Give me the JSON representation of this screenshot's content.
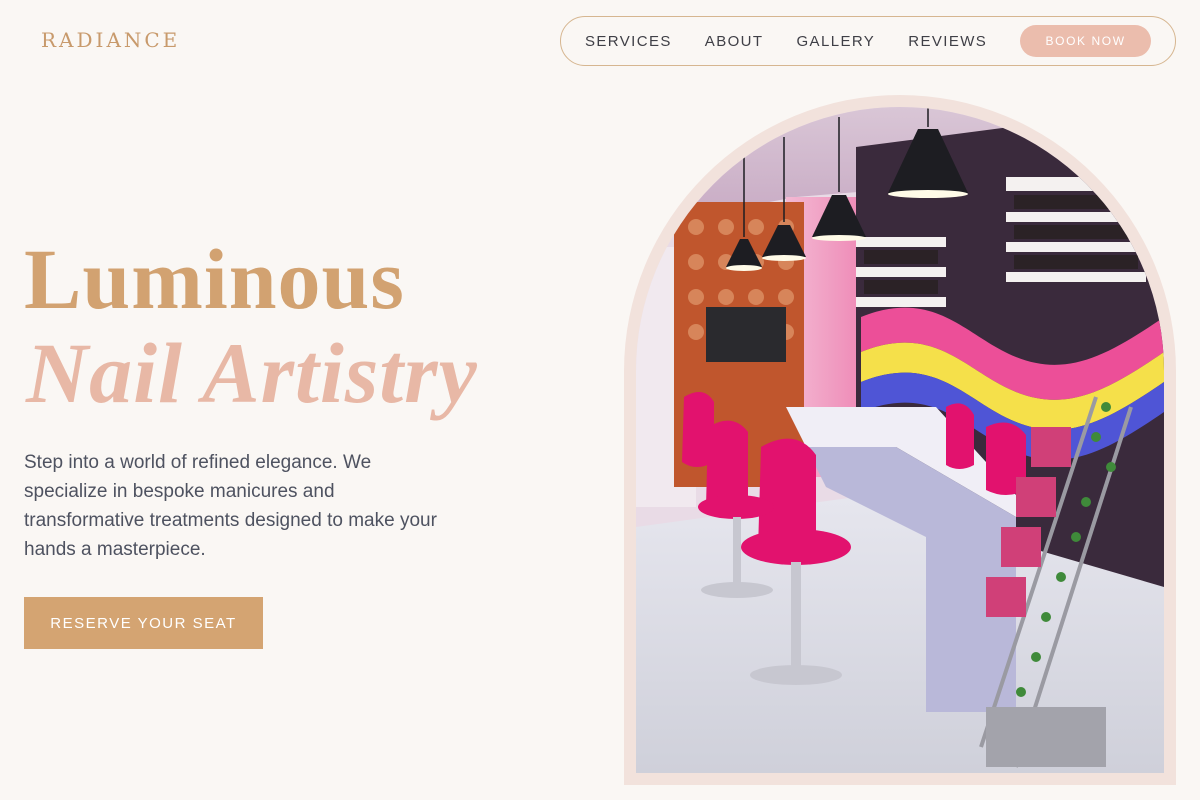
{
  "brand": {
    "logo": "RADIANCE"
  },
  "nav": {
    "links": [
      "SERVICES",
      "ABOUT",
      "GALLERY",
      "REVIEWS"
    ],
    "cta": "BOOK NOW"
  },
  "hero": {
    "title_line1": "Luminous",
    "title_line2": "Nail Artistry",
    "description": "Step into a world of refined elegance. We specialize in bespoke manicures and transformative treatments designed to make your hands a masterpiece.",
    "cta": "RESERVE YOUR SEAT"
  },
  "image": {
    "subject": "nail salon interior with pink chairs and rainbow wall"
  },
  "colors": {
    "background": "#faf7f4",
    "gold": "#d4a472",
    "blush": "#ebbdad",
    "nav_border": "#d6b690",
    "text": "#4e5260"
  }
}
